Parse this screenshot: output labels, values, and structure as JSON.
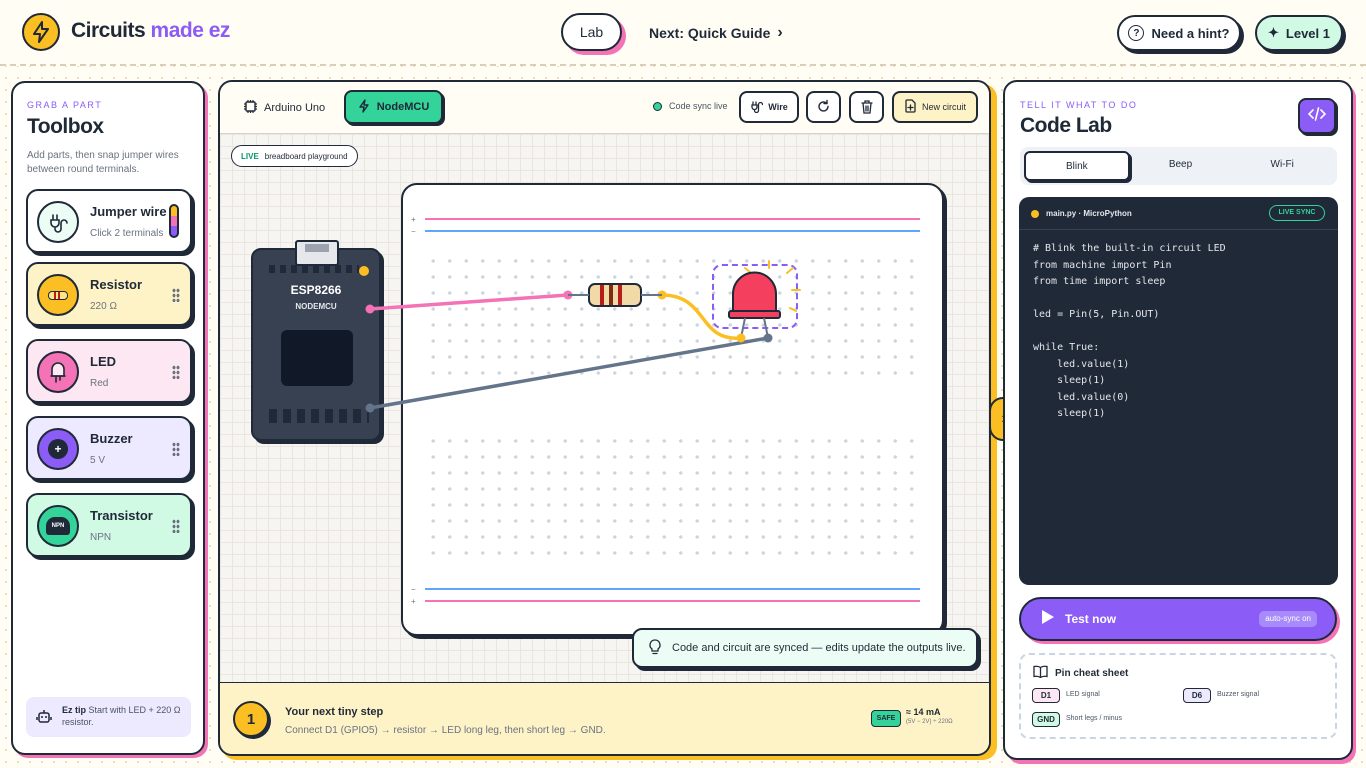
{
  "header": {
    "logo_word": "Circuits",
    "logo_accent": " made ez",
    "lab_tab": "Lab",
    "next_prefix": "Next: ",
    "next_label": "Quick Guide",
    "hint_button": "Need a hint?",
    "level_badge": "Level 1"
  },
  "toolbox": {
    "eyebrow": "GRAB A PART",
    "title": "Toolbox",
    "description": "Add parts, then snap jumper wires between round terminals.",
    "items": [
      {
        "name": "Jumper wire",
        "sub": "Click 2 terminals"
      },
      {
        "name": "Resistor",
        "sub": "220 Ω"
      },
      {
        "name": "LED",
        "sub": "Red"
      },
      {
        "name": "Buzzer",
        "sub": "5 V"
      },
      {
        "name": "Transistor",
        "sub": "NPN",
        "icon_text": "NPN"
      }
    ],
    "tip_label": "Ez tip",
    "tip_text": " Start with LED + 220 Ω resistor."
  },
  "workspace": {
    "boards": [
      "Arduino Uno",
      "NodeMCU"
    ],
    "sync_status": "Code sync live",
    "wire_button": "Wire",
    "new_circuit_button": "New circuit",
    "live_badge": "LIVE",
    "canvas_label": "breadboard playground",
    "board_name": "ESP8266",
    "board_sub": "NODEMCU",
    "rail_plus": "+",
    "rail_minus": "−",
    "toast": "Code and circuit are synced — edits update the outputs live.",
    "step_number": "1",
    "step_title": "Your next tiny step",
    "step_text": "Connect D1 (GPIO5) → resistor → LED long leg, then short leg → GND.",
    "safe_badge": "SAFE",
    "current_value": "≈ 14 mA",
    "current_formula": "(5V − 2V) ÷ 220Ω"
  },
  "codelab": {
    "eyebrow": "TELL IT WHAT TO DO",
    "title": "Code Lab",
    "tabs": [
      "Blink",
      "Beep",
      "Wi-Fi"
    ],
    "active_tab": "Blink",
    "file": "main.py · MicroPython",
    "sync_badge": "LIVE SYNC",
    "code": "# Blink the built-in circuit LED\nfrom machine import Pin\nfrom time import sleep\n\nled = Pin(5, Pin.OUT)\n\nwhile True:\n    led.value(1)\n    sleep(1)\n    led.value(0)\n    sleep(1)",
    "test_button": "Test now",
    "auto_sync": "auto-sync on",
    "cheat_title": "Pin cheat sheet",
    "pins": [
      {
        "pin": "D1",
        "desc": "LED signal"
      },
      {
        "pin": "D6",
        "desc": "Buzzer signal"
      },
      {
        "pin": "GND",
        "desc": "Short legs / minus"
      }
    ]
  },
  "colors": {
    "accent": "#8b5cf6",
    "yellow": "#fbbf24",
    "green": "#34d399",
    "pink": "#f472b6",
    "dark": "#1f2937"
  }
}
